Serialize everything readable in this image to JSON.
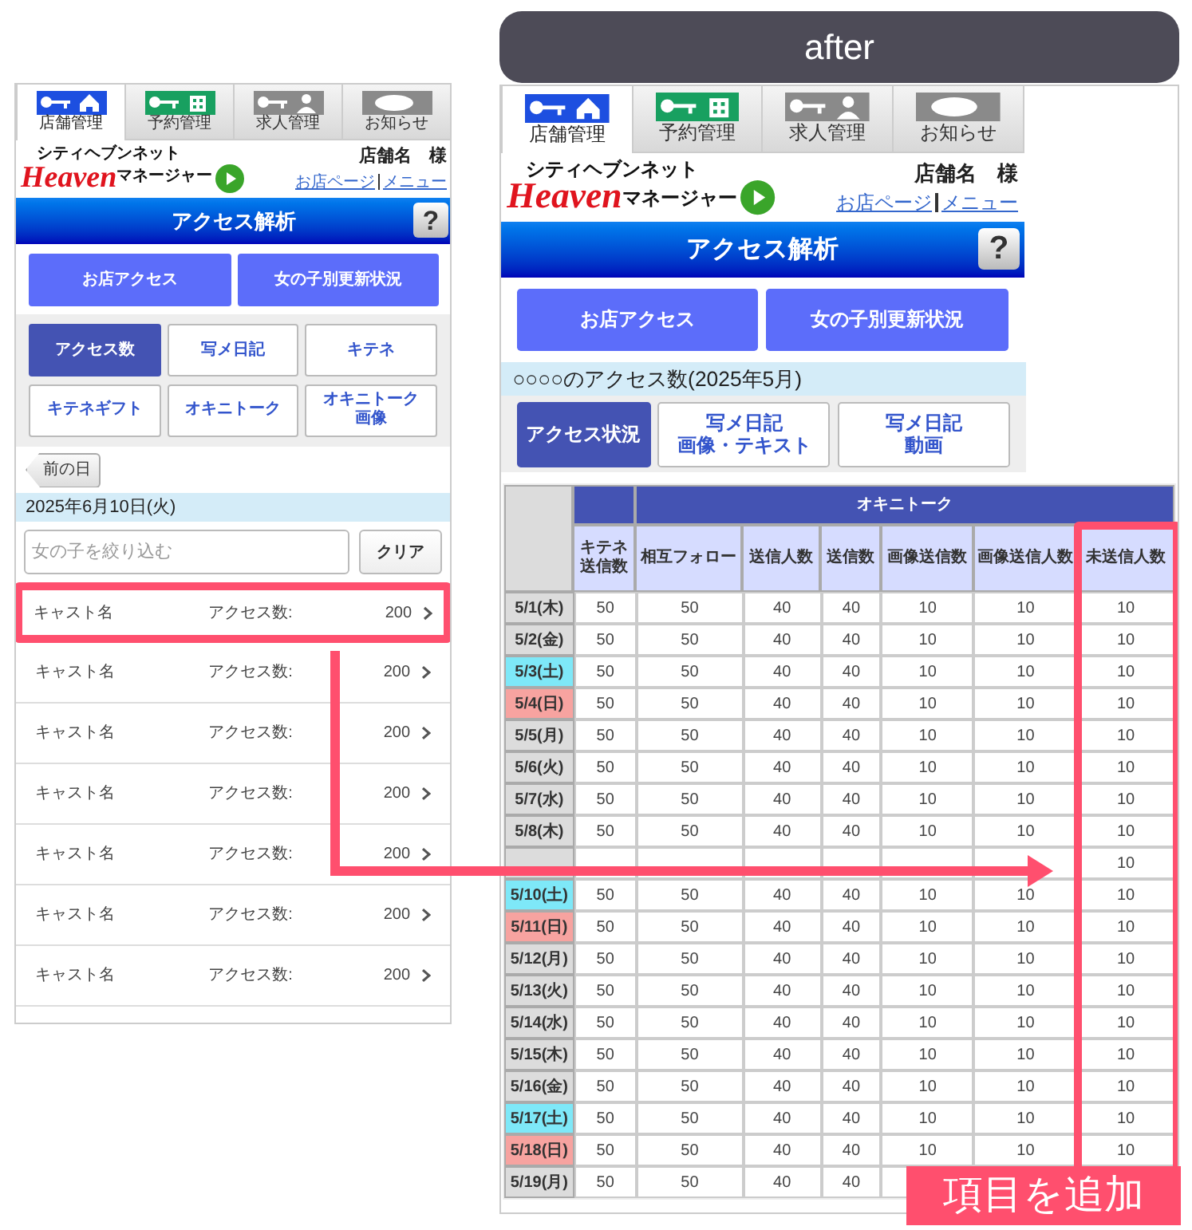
{
  "before_screen": {
    "tabs": [
      {
        "label": "店舗管理",
        "selected": true
      },
      {
        "label": "予約管理",
        "selected": false
      },
      {
        "label": "求人管理",
        "selected": false
      },
      {
        "label": "お知らせ",
        "selected": false
      }
    ],
    "logo": {
      "kicker": "シティヘブンネット",
      "brand": "Heaven",
      "product": "マネージャー"
    },
    "shop_name": "店舗名　様",
    "links": [
      "お店ページ",
      "メニュー"
    ],
    "title": "アクセス解析",
    "help": "?",
    "main_buttons": [
      "お店アクセス",
      "女の子別更新状況"
    ],
    "sub_buttons": [
      {
        "lines": [
          "アクセス数"
        ],
        "selected": true
      },
      {
        "lines": [
          "写メ日記"
        ],
        "selected": false
      },
      {
        "lines": [
          "キテネ"
        ],
        "selected": false
      },
      {
        "lines": [
          "キテネギフト"
        ],
        "selected": false
      },
      {
        "lines": [
          "オキニトーク"
        ],
        "selected": false
      },
      {
        "lines": [
          "オキニトーク",
          "画像"
        ],
        "selected": false
      }
    ],
    "prev_button": "前の日",
    "date": "2025年6月10日(火)",
    "filter": {
      "placeholder": "女の子を絞り込む"
    },
    "clear_button": "クリア",
    "rows": [
      {
        "name": "キャスト名",
        "label": "アクセス数:",
        "count": "200",
        "highlighted": true
      },
      {
        "name": "キャスト名",
        "label": "アクセス数:",
        "count": "200",
        "highlighted": false
      },
      {
        "name": "キャスト名",
        "label": "アクセス数:",
        "count": "200",
        "highlighted": false
      },
      {
        "name": "キャスト名",
        "label": "アクセス数:",
        "count": "200",
        "highlighted": false
      },
      {
        "name": "キャスト名",
        "label": "アクセス数:",
        "count": "200",
        "highlighted": false
      },
      {
        "name": "キャスト名",
        "label": "アクセス数:",
        "count": "200",
        "highlighted": false
      },
      {
        "name": "キャスト名",
        "label": "アクセス数:",
        "count": "200",
        "highlighted": false
      }
    ]
  },
  "after_label": "after",
  "after_screen": {
    "tabs": [
      {
        "label": "店舗管理",
        "selected": true
      },
      {
        "label": "予約管理",
        "selected": false
      },
      {
        "label": "求人管理",
        "selected": false
      },
      {
        "label": "お知らせ",
        "selected": false
      }
    ],
    "logo": {
      "kicker": "シティヘブンネット",
      "brand": "Heaven",
      "product": "マネージャー"
    },
    "shop_name": "店舗名　様",
    "links": [
      "お店ページ",
      "メニュー"
    ],
    "title": "アクセス解析",
    "help": "?",
    "main_buttons": [
      "お店アクセス",
      "女の子別更新状況"
    ],
    "heading": "○○○○のアクセス数(2025年5月)",
    "sub_buttons": [
      {
        "lines": [
          "アクセス状況"
        ],
        "selected": true
      },
      {
        "lines": [
          "写メ日記",
          "画像・テキスト"
        ],
        "selected": false
      },
      {
        "lines": [
          "写メ日記",
          "動画"
        ],
        "selected": false
      }
    ],
    "table": {
      "group_header": "オキニトーク",
      "columns": [
        {
          "lines": [
            "キテネ",
            "送信数"
          ],
          "highlighted": false
        },
        {
          "lines": [
            "相互フォロー"
          ],
          "highlighted": false
        },
        {
          "lines": [
            "送信人数"
          ],
          "highlighted": false
        },
        {
          "lines": [
            "送信数"
          ],
          "highlighted": false
        },
        {
          "lines": [
            "画像送信数"
          ],
          "highlighted": false
        },
        {
          "lines": [
            "画像送信人数"
          ],
          "highlighted": false
        },
        {
          "lines": [
            "未送信人数"
          ],
          "highlighted": true
        }
      ],
      "rows": [
        {
          "date": "5/1(木)",
          "color": "#dcdcdc",
          "values": [
            "50",
            "50",
            "40",
            "40",
            "10",
            "10",
            "10"
          ]
        },
        {
          "date": "5/2(金)",
          "color": "#dcdcdc",
          "values": [
            "50",
            "50",
            "40",
            "40",
            "10",
            "10",
            "10"
          ]
        },
        {
          "date": "5/3(土)",
          "color": "#7ee8f8",
          "values": [
            "50",
            "50",
            "40",
            "40",
            "10",
            "10",
            "10"
          ]
        },
        {
          "date": "5/4(日)",
          "color": "#f7a3a0",
          "values": [
            "50",
            "50",
            "40",
            "40",
            "10",
            "10",
            "10"
          ]
        },
        {
          "date": "5/5(月)",
          "color": "#dcdcdc",
          "values": [
            "50",
            "50",
            "40",
            "40",
            "10",
            "10",
            "10"
          ]
        },
        {
          "date": "5/6(火)",
          "color": "#dcdcdc",
          "values": [
            "50",
            "50",
            "40",
            "40",
            "10",
            "10",
            "10"
          ]
        },
        {
          "date": "5/7(水)",
          "color": "#dcdcdc",
          "values": [
            "50",
            "50",
            "40",
            "40",
            "10",
            "10",
            "10"
          ]
        },
        {
          "date": "5/8(木)",
          "color": "#dcdcdc",
          "values": [
            "50",
            "50",
            "40",
            "40",
            "10",
            "10",
            "10"
          ]
        },
        {
          "color": "#dcdcdc",
          "values": [
            "10"
          ],
          "values_from_right": true
        },
        {
          "date": "5/10(土)",
          "color": "#7ee8f8",
          "values": [
            "50",
            "50",
            "40",
            "40",
            "10",
            "10",
            "10"
          ]
        },
        {
          "date": "5/11(日)",
          "color": "#f7a3a0",
          "values": [
            "50",
            "50",
            "40",
            "40",
            "10",
            "10",
            "10"
          ]
        },
        {
          "date": "5/12(月)",
          "color": "#dcdcdc",
          "values": [
            "50",
            "50",
            "40",
            "40",
            "10",
            "10",
            "10"
          ]
        },
        {
          "date": "5/13(火)",
          "color": "#dcdcdc",
          "values": [
            "50",
            "50",
            "40",
            "40",
            "10",
            "10",
            "10"
          ]
        },
        {
          "date": "5/14(水)",
          "color": "#dcdcdc",
          "values": [
            "50",
            "50",
            "40",
            "40",
            "10",
            "10",
            "10"
          ]
        },
        {
          "date": "5/15(木)",
          "color": "#dcdcdc",
          "values": [
            "50",
            "50",
            "40",
            "40",
            "10",
            "10",
            "10"
          ]
        },
        {
          "date": "5/16(金)",
          "color": "#dcdcdc",
          "values": [
            "50",
            "50",
            "40",
            "40",
            "10",
            "10",
            "10"
          ]
        },
        {
          "date": "5/17(土)",
          "color": "#7ee8f8",
          "values": [
            "50",
            "50",
            "40",
            "40",
            "10",
            "10",
            "10"
          ]
        },
        {
          "date": "5/18(日)",
          "color": "#f7a3a0",
          "values": [
            "50",
            "50",
            "40",
            "40",
            "10",
            "10",
            "10"
          ]
        },
        {
          "date": "5/19(月)",
          "color": "#dcdcdc",
          "values": [
            "50",
            "50",
            "40",
            "40"
          ]
        }
      ]
    }
  },
  "callout": "項目を追加"
}
